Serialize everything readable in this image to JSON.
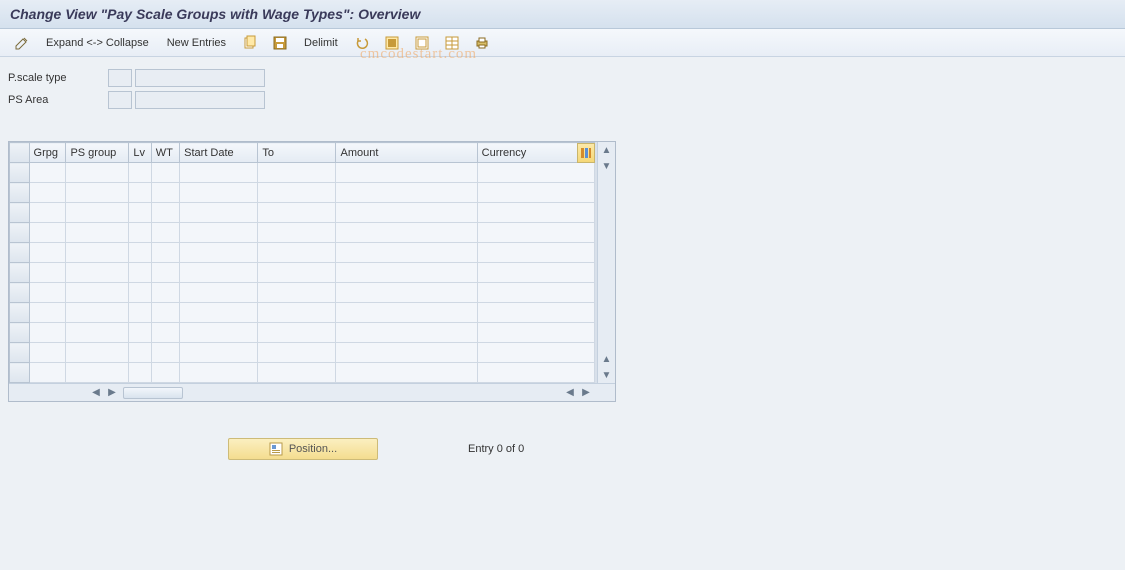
{
  "title": "Change View \"Pay Scale Groups with Wage Types\": Overview",
  "toolbar": {
    "expand_collapse": "Expand <-> Collapse",
    "new_entries": "New Entries",
    "delimit": "Delimit"
  },
  "fields": {
    "pscale_type": {
      "label": "P.scale type",
      "code": "",
      "value": ""
    },
    "ps_area": {
      "label": "PS Area",
      "code": "",
      "value": ""
    }
  },
  "grid": {
    "columns": {
      "grpg": "Grpg",
      "ps_group": "PS group",
      "lv": "Lv",
      "wt": "WT",
      "start_date": "Start Date",
      "to": "To",
      "amount": "Amount",
      "currency": "Currency"
    },
    "rows": 11
  },
  "footer": {
    "position_label": "Position...",
    "entry_text": "Entry 0 of 0"
  },
  "watermark": "cmcodestart.com"
}
